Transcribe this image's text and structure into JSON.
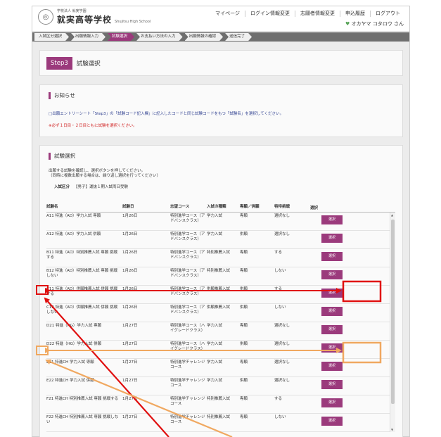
{
  "header": {
    "logo_small": "学校法人 就実学園",
    "logo_main": "就実高等学校",
    "logo_en": "Shujitsu High School",
    "nav": [
      "マイページ",
      "ログイン情報変更",
      "志願者情報変更",
      "申込履歴",
      "ログアウト"
    ],
    "user_name": "オカヤマ コタロウ さん"
  },
  "steps": [
    "入試区分選択",
    "出願情報入力",
    "試験選択",
    "お支払い方法の入力",
    "出願情報の確認",
    "送信完了"
  ],
  "active_step": 2,
  "step_title": {
    "badge": "Step3",
    "name": "試験選択"
  },
  "notice": {
    "title": "お知らせ",
    "line1": "□出願エントリーシート「Step3」の「試験コード記入欄」に記入したコードと同じ試験コードをもつ「試験名」を選択してください。",
    "line2": "※必ず１日目・２日目ともに試験を選択ください。"
  },
  "selection": {
    "title": "試験選択",
    "instr1": "出願する試験を確認し、選択ボタンを押してください。",
    "instr2": "（同時に複数出願する場合は、繰り返し選択を行ってください）",
    "category_label": "入試区分",
    "category_value": "【男子】運抜１期入試両日受験"
  },
  "table": {
    "headers": [
      "試験名",
      "試験日",
      "志望コース",
      "入試の種類",
      "専願／併願",
      "特待挑戦",
      "選択"
    ],
    "button_label": "選択",
    "rows": [
      {
        "name": "A11 特進（AD）学力入試 専願",
        "date": "1月26日",
        "course": "特別進学コース（アドバンスクラス）",
        "type": "学力入試",
        "plan": "専願",
        "challenge": "選択なし"
      },
      {
        "name": "A12 特進（AD）学力入試 併願",
        "date": "1月26日",
        "course": "特別進学コース（アドバンスクラス）",
        "type": "学力入試",
        "plan": "併願",
        "challenge": "選択なし"
      },
      {
        "name": "B11 特進（AD）特別推薦入試 専願 挑戦する",
        "date": "1月26日",
        "course": "特別進学コース（アドバンスクラス）",
        "type": "特別推薦入試",
        "plan": "専願",
        "challenge": "する"
      },
      {
        "name": "B12 特進（AD）特別推薦入試 専願 挑戦しない",
        "date": "1月26日",
        "course": "特別進学コース（アドバンスクラス）",
        "type": "特別推薦入試",
        "plan": "専願",
        "challenge": "しない"
      },
      {
        "name": "C11 特進（AD）併願推薦入試 併願 挑戦する",
        "date": "1月26日",
        "course": "特別進学コース（アドバンスクラス）",
        "type": "併願推薦入試",
        "plan": "併願",
        "challenge": "する"
      },
      {
        "name": "C12 特進（AD）併願推薦入試 併願 挑戦しない",
        "date": "1月26日",
        "course": "特別進学コース（アドバンスクラス）",
        "type": "併願推薦入試",
        "plan": "併願",
        "challenge": "しない"
      },
      {
        "name": "D21 特進（HG）学力入試 専願",
        "date": "1月27日",
        "course": "特別進学コース（ハイグレードクラス）",
        "type": "学力入試",
        "plan": "専願",
        "challenge": "選択なし"
      },
      {
        "name": "D22 特進（HG）学力入試 併願",
        "date": "1月27日",
        "course": "特別進学コース（ハイグレードクラス）",
        "type": "学力入試",
        "plan": "併願",
        "challenge": "選択なし"
      },
      {
        "name": "E21 特進CH 学力入試 専願",
        "date": "1月27日",
        "course": "特別進学チャレンジコース",
        "type": "学力入試",
        "plan": "専願",
        "challenge": "選択なし"
      },
      {
        "name": "E22 特進CH 学力入試 併願",
        "date": "1月27日",
        "course": "特別進学チャレンジコース",
        "type": "学力入試",
        "plan": "併願",
        "challenge": "選択なし"
      },
      {
        "name": "F21 特進CH 特別推薦入試 専願 挑戦する",
        "date": "1月27日",
        "course": "特別進学チャレンジコース",
        "type": "特別推薦入試",
        "plan": "専願",
        "challenge": "する"
      },
      {
        "name": "F22 特進CH 特別推薦入試 専願 挑戦しない",
        "date": "1月27日",
        "course": "特別進学チャレンジコース",
        "type": "特別推薦入試",
        "plan": "専願",
        "challenge": "しない"
      }
    ]
  },
  "colors": {
    "accent": "#9b3a7c",
    "highlight_red": "#e01010",
    "highlight_orange": "#f0a860"
  }
}
